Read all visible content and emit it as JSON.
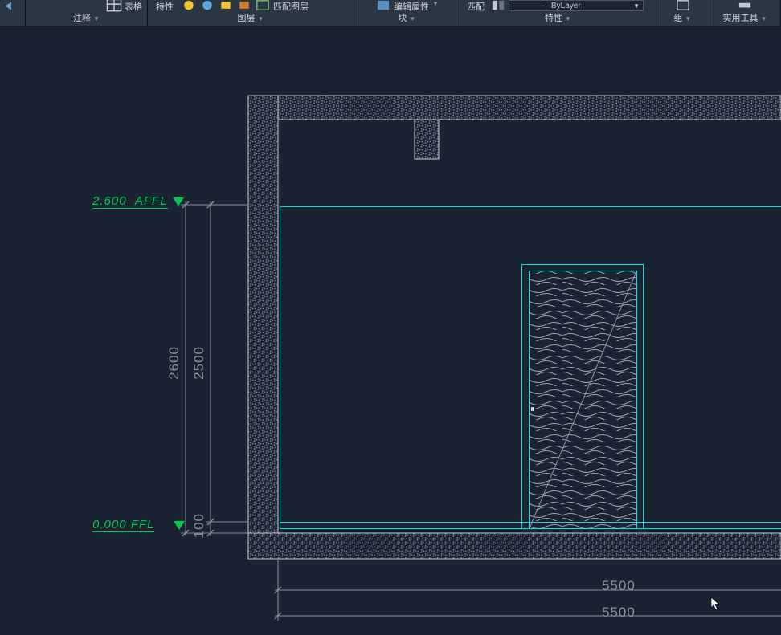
{
  "ribbon": {
    "panels": [
      {
        "id": "history",
        "title": "",
        "label_a": "",
        "label_b": ""
      },
      {
        "id": "annotate",
        "title": "注释",
        "label_a": "",
        "label_b": "表格"
      },
      {
        "id": "layers",
        "title": "图层",
        "label_a": "特性",
        "label_b": ""
      },
      {
        "id": "block",
        "title": "块",
        "label_a": "编辑属性",
        "label_b": ""
      },
      {
        "id": "properties",
        "title": "特性",
        "label_a": "匹配",
        "select": "ByLayer"
      },
      {
        "id": "group",
        "title": "组"
      },
      {
        "id": "utilities",
        "title": "实用工具"
      }
    ]
  },
  "drawing": {
    "ffl_top": {
      "level": "2.600",
      "label": "AFFL"
    },
    "ffl_bottom": {
      "level": "0.000",
      "label": "FFL"
    },
    "dim_2600": "2600",
    "dim_2500": "2500",
    "dim_100": "100",
    "dim_5500a": "5500",
    "dim_5500b": "5500"
  }
}
